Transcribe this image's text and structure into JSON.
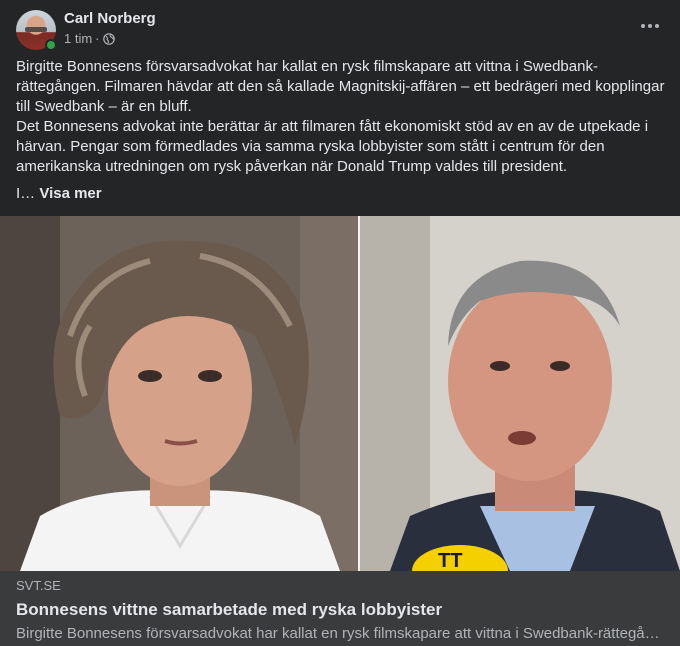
{
  "post": {
    "author": "Carl Norberg",
    "time": "1 tim",
    "separator": "·",
    "privacy_icon": "globe-icon",
    "paragraph_1": "Birgitte Bonnesens försvarsadvokat har kallat en rysk filmskapare att vittna i Swedbank-rättegången. Filmaren hävdar att den så kallade Magnitskij-affären – ett bedrägeri med kopplingar till Swedbank – är en bluff.",
    "paragraph_2": "Det Bonnesens advokat inte berättar är att filmaren fått ekonomiskt stöd av en av de utpekade i härvan. Pengar som förmedlades via samma ryska lobbyister som stått i centrum för den amerikanska utredningen om rysk påverkan när Donald Trump valdes till president.",
    "truncated_start": "I…",
    "see_more_label": "Visa mer"
  },
  "link_preview": {
    "domain": "SVT.SE",
    "title": "Bonnesens vittne samarbetade med ryska lobbyister",
    "description": "Birgitte Bonnesens försvarsadvokat har kallat en rysk filmskapare att vittna i Swedbank-rättegången. Filmaren hävdar att den så kallade Magnitskij-affären"
  },
  "colors": {
    "background": "#242526",
    "footer": "#3a3b3c",
    "text_primary": "#e4e6eb",
    "text_secondary": "#b0b3b8",
    "online": "#31a24c",
    "svt_yellow": "#f5d000"
  }
}
